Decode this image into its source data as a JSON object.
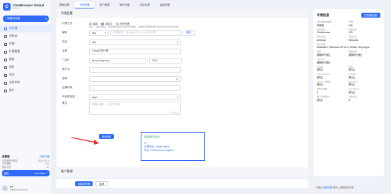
{
  "app": {
    "name": "ClonBrowser Global",
    "version": "5.0.4"
  },
  "sidebar": {
    "new_button": "+ 新建浏览器",
    "items": [
      {
        "label": "浏览器",
        "icon": "browser-icon"
      },
      {
        "label": "回收站",
        "icon": "trash-icon"
      },
      {
        "label": "代理",
        "icon": "proxy-icon"
      },
      {
        "label": "扩展管理",
        "icon": "extension-icon"
      },
      {
        "label": "群组",
        "icon": "folder-icon"
      },
      {
        "label": "团队",
        "icon": "team-icon"
      },
      {
        "label": "安全",
        "icon": "security-icon"
      },
      {
        "label": "合作伙伴",
        "icon": "partner-icon"
      },
      {
        "label": "账户",
        "icon": "account-icon"
      }
    ],
    "plan": {
      "title": "免费版",
      "upgrade": "立即升级",
      "rows": [
        [
          "浏览器有效期至",
          "2025-03-15"
        ],
        [
          "浏览器数",
          "1/10"
        ],
        [
          "团队成员",
          "0/1"
        ]
      ],
      "bar_label": "团队",
      "bar_value": "Ace Team ?"
    },
    "user": {
      "name": "lee",
      "email": "lee@clonsy.com"
    }
  },
  "tabs": [
    "基础设置",
    "代理设置",
    "账户管理",
    "偏好设置",
    "功能设置",
    "高级设置"
  ],
  "proxy": {
    "section_title": "代理设置",
    "type_label": "代理方式",
    "type_options": [
      "直连",
      "自定义",
      "已有代理"
    ],
    "type_hint": "提示：设置代理后，浏览器将使用该代理访问网络，请确保代理服务器可用且符合当地法律法规。",
    "parse_label": "解析",
    "parse_select": "http",
    "parse_placeholder": "代理地址：例 http://127.0.0.1:8080 等",
    "parse_button": "解析",
    "protocol_label": "协议",
    "protocol_value": "http",
    "name_label": "名称",
    "name_value": "Cissy住宅代理",
    "host_label": "* 主机",
    "host_value": "proxy.cissy.com",
    "port_value": "2312",
    "user_label": "账户名",
    "pass_label": "密码",
    "expire_label": "过期时间",
    "ipcheck_label": "IP信息检测",
    "ipcheck_value": "ipapi",
    "note_label": "备注",
    "note_placeholder": "请输入备注，以分号分隔",
    "note_count": "0/1500",
    "test_button": "检查网络",
    "result": {
      "ok": "连接测试成功！",
      "ip": "IP:",
      "location": "位置信息: United States",
      "zone": "时区: America/Los_Angeles"
    }
  },
  "account_section": "账户管理",
  "footer": {
    "ok": "创建浏览器",
    "cancel": "取消"
  },
  "env": {
    "title": "环境信息",
    "generate_button": "生成随机指纹",
    "fields": [
      {
        "k": "浏览器指纹版本",
        "v": "标准版"
      },
      {
        "k": "代理",
        "v": "http"
      },
      {
        "k": "内核名称",
        "v": "ClonBrowser"
      },
      {
        "k": "内核版本",
        "v": "130"
      },
      {
        "k": "操作系统",
        "v": "windows"
      },
      {
        "k": "系统平台",
        "v": "Windows"
      },
      {
        "k": "用户代理",
        "v": "Mozilla/5.0 (Windows NT 10.0; Win64; x64) Apple...",
        "full": true
      },
      {
        "k": "时区",
        "v": "[跟随IP匹配]"
      },
      {
        "k": "地理位置",
        "v": "[跟随IP匹配]"
      },
      {
        "k": "WebRTC",
        "v": "[跟随IP匹配]",
        "full": true
      },
      {
        "k": "分辨率",
        "v": "[默认]"
      },
      {
        "k": "字体",
        "v": "[默认]"
      },
      {
        "k": "AudioContext",
        "v": "[默认]"
      },
      {
        "k": "Canvas",
        "v": "[默认]"
      },
      {
        "k": "WebGL元数据",
        "v": "[默认]"
      },
      {
        "k": "WebGPU",
        "v": "[默认]"
      },
      {
        "k": "硬件并发数",
        "v": "8"
      },
      {
        "k": "ClientRects",
        "v": "[默认]"
      },
      {
        "k": "端口扫描保护",
        "v": "[默认]"
      },
      {
        "k": "设备内存",
        "v": "8"
      }
    ],
    "footer_text": "可通过",
    "footer_link": "偏好设置",
    "footer_tail": "修改上述指纹默认值"
  },
  "colors": {
    "accent": "#2f6bff",
    "success": "#1aa35c",
    "arrow": "#e02b2b"
  }
}
